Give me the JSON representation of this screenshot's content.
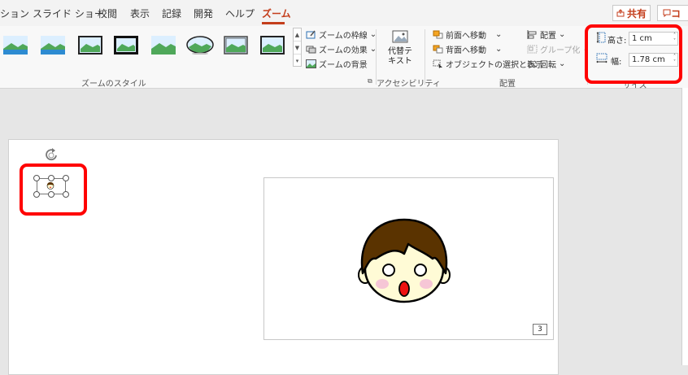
{
  "tabs": [
    {
      "label": "ション",
      "active": false
    },
    {
      "label": "スライド ショー",
      "active": false
    },
    {
      "label": "校閲",
      "active": false
    },
    {
      "label": "表示",
      "active": false
    },
    {
      "label": "記録",
      "active": false
    },
    {
      "label": "開発",
      "active": false
    },
    {
      "label": "ヘルプ",
      "active": false
    },
    {
      "label": "ズーム",
      "active": true
    }
  ],
  "share": {
    "label": "共有",
    "icon": "share-icon"
  },
  "comment": {
    "label": "コ",
    "icon": "comment-icon"
  },
  "zoom_styles": {
    "group_label": "ズームのスタイル",
    "frame_label": "ズームの枠線",
    "effect_label": "ズームの効果",
    "background_label": "ズームの背景"
  },
  "accessibility": {
    "alt_text_label_1": "代替テ",
    "alt_text_label_2": "キスト",
    "group_label": "アクセシビリティ"
  },
  "arrange": {
    "bring_forward": "前面へ移動",
    "send_backward": "背面へ移動",
    "selection_pane": "オブジェクトの選択と表示",
    "align": "配置",
    "group": "グループ化",
    "rotate": "回転",
    "group_label": "配置"
  },
  "size": {
    "height_label": "高さ:",
    "height_value": "1 cm",
    "width_label": "幅:",
    "width_value": "1.78 cm",
    "group_label": "サイズ"
  },
  "slide": {
    "page_number": "3"
  },
  "colors": {
    "accent": "#c43e1c",
    "highlight": "#ff0000",
    "hair": "#5a3300",
    "face": "#fffbd6"
  }
}
